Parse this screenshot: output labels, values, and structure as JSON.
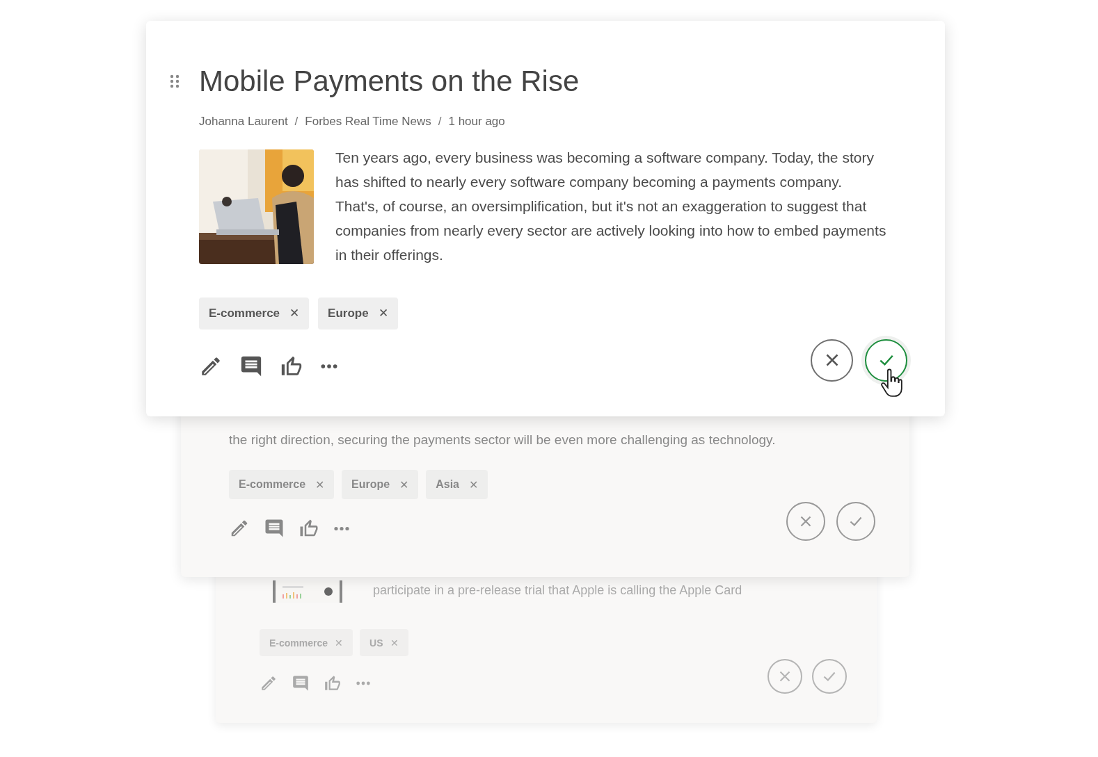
{
  "cards": [
    {
      "title": "Mobile Payments on the Rise",
      "meta": [
        "Johanna Laurent",
        "Forbes Real Time News",
        "1 hour ago"
      ],
      "meta_separator": "/",
      "thumbnail": {
        "kind": "picture"
      },
      "excerpt": "Ten years ago, every business was becoming a software company. Today, the story has shifted to nearly every software company becoming a payments company. That's, of course, an oversimplification, but it's not an exaggeration to suggest that companies from nearly every sector are actively looking into how to embed payments in their offerings.",
      "tags": [
        {
          "label": "E-commerce",
          "remove": "✕"
        },
        {
          "label": "Europe",
          "remove": "✕"
        }
      ],
      "approve_hovered": true
    },
    {
      "excerpt_lines": [
        "the right direction, securing the payments sector will be even more challenging as technology."
      ],
      "tags": [
        {
          "label": "E-commerce",
          "remove": "✕"
        },
        {
          "label": "Europe",
          "remove": "✕"
        },
        {
          "label": "Asia",
          "remove": "✕"
        }
      ],
      "approve_hovered": false
    },
    {
      "thumbnail": {
        "kind": "picture"
      },
      "excerpt_lines": [
        "participate in a pre-release trial that Apple is calling the Apple Card"
      ],
      "tags": [
        {
          "label": "E-commerce",
          "remove": "✕"
        },
        {
          "label": "US",
          "remove": "✕"
        }
      ],
      "approve_hovered": false
    }
  ]
}
